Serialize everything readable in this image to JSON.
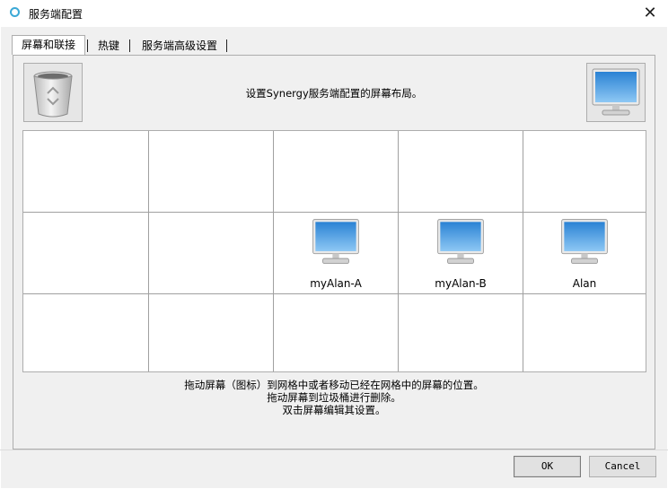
{
  "window": {
    "title": "服务端配置",
    "close_glyph": "✕"
  },
  "tabs": [
    {
      "label": "屏幕和联接",
      "active": true
    },
    {
      "label": "热键",
      "active": false
    },
    {
      "label": "服务端高级设置",
      "active": false
    }
  ],
  "hint_text": "设置Synergy服务端配置的屏幕布局。",
  "grid": {
    "rows": 3,
    "cols": 5,
    "screens": [
      {
        "name": "myAlan-A",
        "row": 1,
        "col": 2
      },
      {
        "name": "myAlan-B",
        "row": 1,
        "col": 3
      },
      {
        "name": "Alan",
        "row": 1,
        "col": 4
      }
    ]
  },
  "instructions": {
    "line1": "拖动屏幕（图标）到网格中或者移动已经在网格中的屏幕的位置。",
    "line2": "拖动屏幕到垃圾桶进行删除。",
    "line3": "双击屏幕编辑其设置。"
  },
  "buttons": {
    "ok": "OK",
    "cancel": "Cancel"
  },
  "colors": {
    "screen_blue": "#2f86d6",
    "app_icon": "#3ca9d6"
  },
  "icons": {
    "trash": "trash-icon",
    "new_screen": "monitor-icon"
  }
}
